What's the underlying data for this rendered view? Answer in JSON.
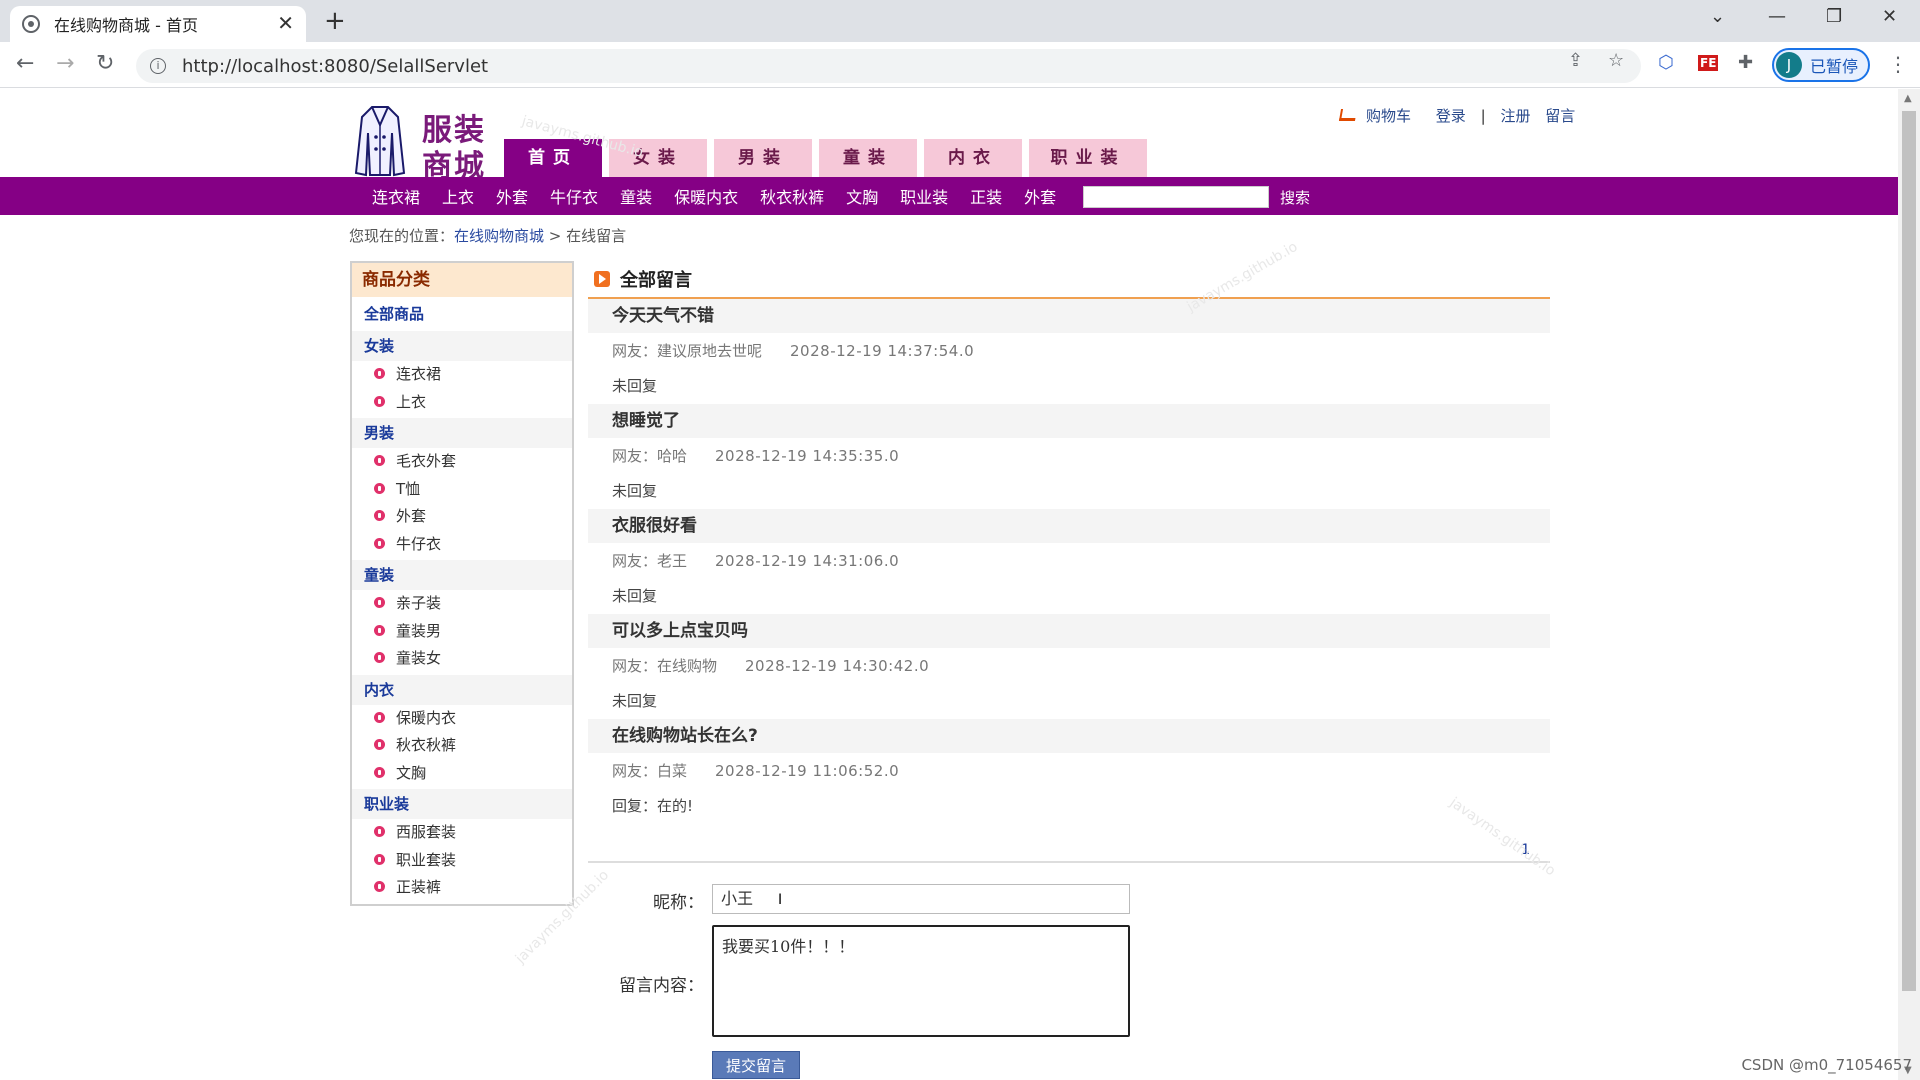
{
  "browser": {
    "tab_title": "在线购物商城 - 首页",
    "url": "http://localhost:8080/SelallServlet",
    "profile_initial": "J",
    "profile_label": "已暂停"
  },
  "header": {
    "logo_line1": "服装",
    "logo_line2": "商城",
    "top_links": {
      "cart": "购物车",
      "login": "登录",
      "sep": "|",
      "register": "注册",
      "message": "留言"
    },
    "main_tabs": [
      {
        "label": "首页",
        "active": true
      },
      {
        "label": "女装",
        "active": false
      },
      {
        "label": "男装",
        "active": false
      },
      {
        "label": "童装",
        "active": false
      },
      {
        "label": "内衣",
        "active": false
      },
      {
        "label": "职业装",
        "active": false
      }
    ],
    "sub_nav": [
      "连衣裙",
      "上衣",
      "外套",
      "牛仔衣",
      "童装",
      "保暖内衣",
      "秋衣秋裤",
      "文胸",
      "职业装",
      "正装",
      "外套"
    ],
    "search_label": "搜索",
    "brand_color": "#850085"
  },
  "breadcrumb": {
    "prefix": "您现在的位置：",
    "link": "在线购物商城",
    "sep": " > ",
    "current": "在线留言"
  },
  "sidebar": {
    "title": "商品分类",
    "all": "全部商品",
    "categories": [
      {
        "name": "女装",
        "items": [
          "连衣裙",
          "上衣"
        ]
      },
      {
        "name": "男装",
        "items": [
          "毛衣外套",
          "T恤",
          "外套",
          "牛仔衣"
        ]
      },
      {
        "name": "童装",
        "items": [
          "亲子装",
          "童装男",
          "童装女"
        ]
      },
      {
        "name": "内衣",
        "items": [
          "保暖内衣",
          "秋衣秋裤",
          "文胸"
        ]
      },
      {
        "name": "职业装",
        "items": [
          "西服套装",
          "职业套装",
          "正装裤"
        ]
      }
    ]
  },
  "messages": {
    "title": "全部留言",
    "list": [
      {
        "subject": "今天天气不错",
        "author": "网友：建议原地去世呢",
        "time": "2028-12-19 14:37:54.0",
        "reply": "未回复"
      },
      {
        "subject": "想睡觉了",
        "author": "网友：哈哈",
        "time": "2028-12-19 14:35:35.0",
        "reply": "未回复"
      },
      {
        "subject": "衣服很好看",
        "author": "网友：老王",
        "time": "2028-12-19 14:31:06.0",
        "reply": "未回复"
      },
      {
        "subject": "可以多上点宝贝吗",
        "author": "网友：在线购物",
        "time": "2028-12-19 14:30:42.0",
        "reply": "未回复"
      },
      {
        "subject": "在线购物站长在么?",
        "author": "网友：白菜",
        "time": "2028-12-19 11:06:52.0",
        "reply": "回复：在的!"
      }
    ],
    "page": "1"
  },
  "form": {
    "nick_label": "昵称：",
    "nick_value": "小王",
    "content_label": "留言内容：",
    "content_value": "我要买10件！！！",
    "submit_label": "提交留言"
  },
  "footer_watermark": "CSDN @m0_71054657",
  "bg_watermark": "javayms.github.io"
}
